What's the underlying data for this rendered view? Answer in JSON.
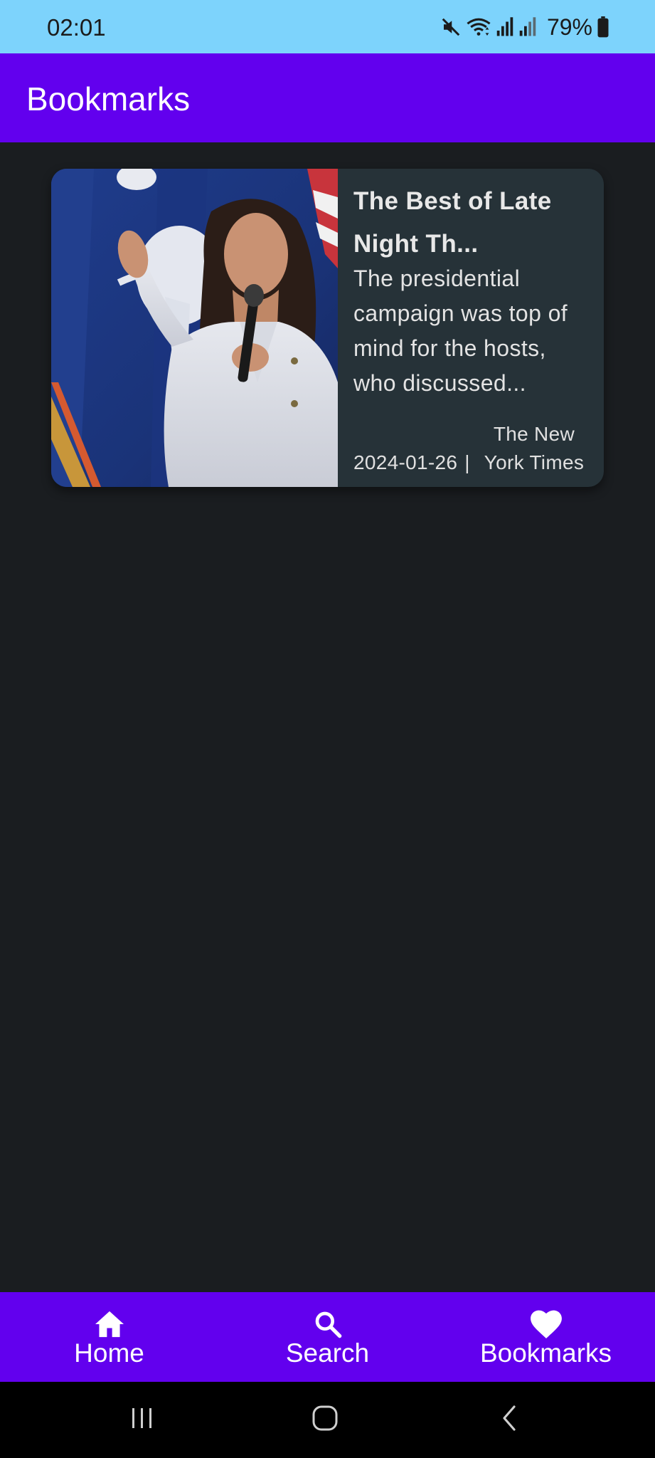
{
  "status_bar": {
    "time": "02:01",
    "battery": "79%",
    "icons": [
      "mute-icon",
      "wifi-icon",
      "signal-icon",
      "signal-icon",
      "battery-icon"
    ]
  },
  "app_bar": {
    "title": "Bookmarks"
  },
  "bookmarks": [
    {
      "title": "The Best of Late Night Th...",
      "description": "The presidential campaign was top of mind for the hosts, who discussed...",
      "date": "2024-01-26",
      "separator": "|",
      "source": "The New York Times"
    }
  ],
  "bottom_nav": {
    "items": [
      {
        "label": "Home",
        "icon": "home-icon"
      },
      {
        "label": "Search",
        "icon": "search-icon"
      },
      {
        "label": "Bookmarks",
        "icon": "heart-icon"
      }
    ]
  },
  "system_nav": {
    "icons": [
      "recents-icon",
      "home-button-icon",
      "back-icon"
    ]
  },
  "colors": {
    "status_bar": "#7dd3fc",
    "primary": "#6200ee",
    "background": "#1a1d20",
    "card": "#263238",
    "text": "#ffffff"
  }
}
